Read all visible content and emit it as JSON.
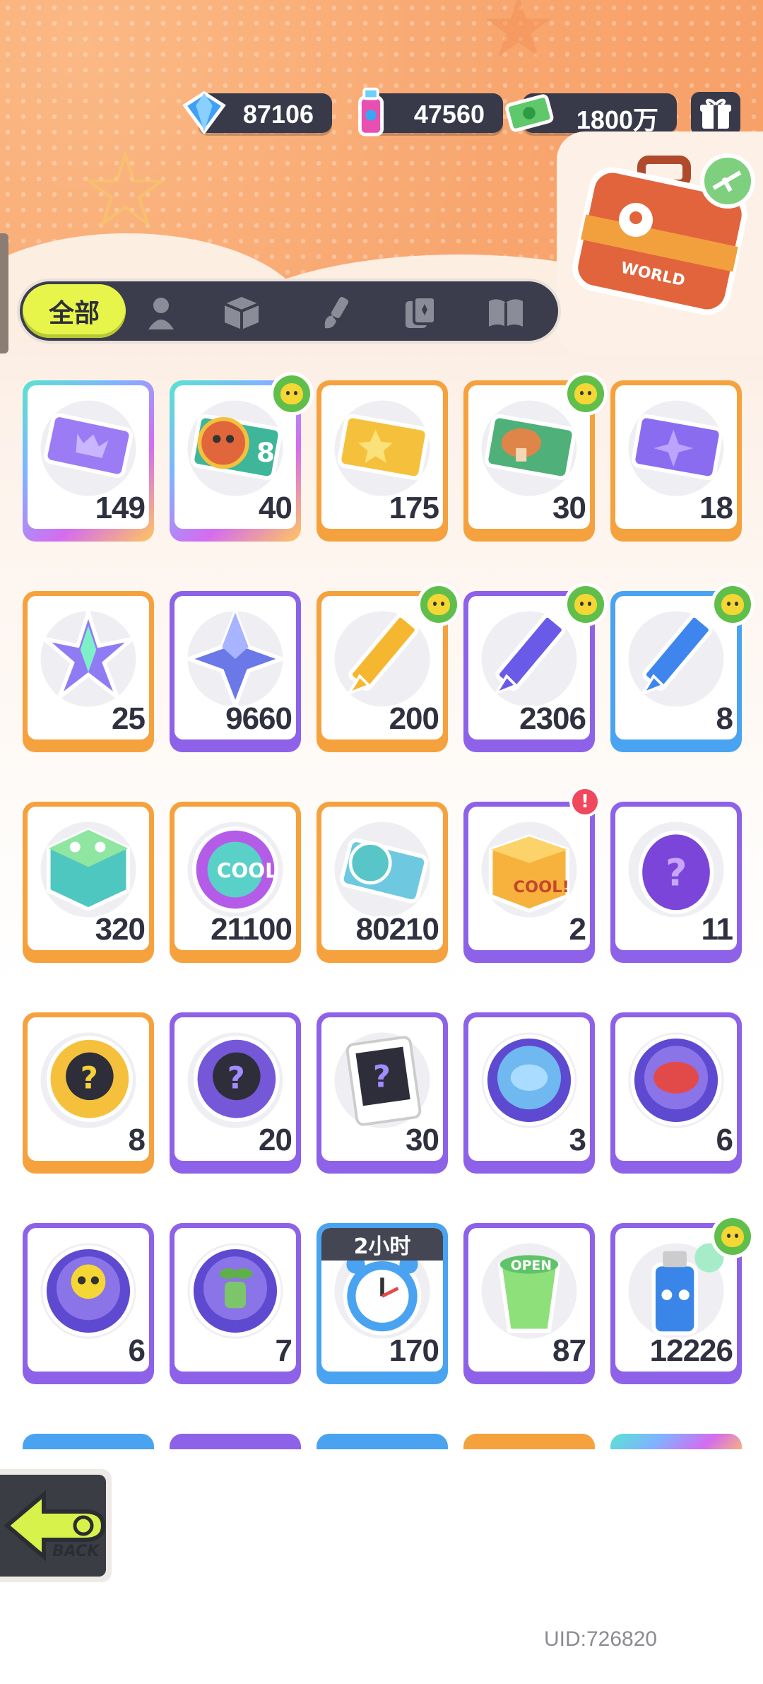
{
  "currencies": [
    {
      "name": "diamond",
      "value": "87106",
      "icon": "diamond-icon"
    },
    {
      "name": "spray-paint",
      "value": "47560",
      "icon": "spray-can-icon"
    },
    {
      "name": "cash",
      "value": "1800万",
      "icon": "money-icon"
    }
  ],
  "tabs": [
    {
      "label": "全部",
      "icon": "all",
      "selected": true
    },
    {
      "label": "",
      "icon": "person-icon"
    },
    {
      "label": "",
      "icon": "box-icon"
    },
    {
      "label": "",
      "icon": "brush-icon"
    },
    {
      "label": "",
      "icon": "cards-icon"
    },
    {
      "label": "",
      "icon": "book-icon"
    }
  ],
  "world_label": "WORLD",
  "items": [
    {
      "name": "crown-ticket",
      "count": "149",
      "frame": "rainbow",
      "art": "ticket-purple"
    },
    {
      "name": "lion-dance-ticket",
      "count": "40",
      "frame": "rainbow",
      "art": "ticket-lion",
      "badge": true
    },
    {
      "name": "gold-star-ticket",
      "count": "175",
      "frame": "orange",
      "art": "ticket-gold"
    },
    {
      "name": "mushroom-ticket",
      "count": "30",
      "frame": "orange",
      "art": "ticket-green",
      "badge": true
    },
    {
      "name": "purple-star-ticket",
      "count": "18",
      "frame": "orange",
      "art": "ticket-violet"
    },
    {
      "name": "rainbow-crystal",
      "count": "25",
      "frame": "orange",
      "art": "crystal-rainbow"
    },
    {
      "name": "blue-crystal",
      "count": "9660",
      "frame": "purple",
      "art": "crystal-blue"
    },
    {
      "name": "yellow-crayon",
      "count": "200",
      "frame": "orange",
      "art": "crayon-yellow",
      "badge": true
    },
    {
      "name": "purple-crayon",
      "count": "2306",
      "frame": "purple",
      "art": "crayon-purple",
      "badge": true
    },
    {
      "name": "blue-crayon",
      "count": "8",
      "frame": "blue",
      "art": "crayon-blue",
      "badge": true
    },
    {
      "name": "color-cube",
      "count": "320",
      "frame": "orange",
      "art": "cube"
    },
    {
      "name": "cool-badge",
      "count": "21100",
      "frame": "orange",
      "art": "cool"
    },
    {
      "name": "season-ticket",
      "count": "80210",
      "frame": "orange",
      "art": "season"
    },
    {
      "name": "cool-box",
      "count": "2",
      "frame": "purple",
      "art": "box",
      "alert": "!"
    },
    {
      "name": "mystery-egg",
      "count": "11",
      "frame": "purple",
      "art": "egg"
    },
    {
      "name": "deity-mystery-gold",
      "count": "8",
      "frame": "orange",
      "art": "deity-gold"
    },
    {
      "name": "deity-mystery-purple",
      "count": "20",
      "frame": "purple",
      "art": "deity-purple"
    },
    {
      "name": "travel-mystery-card",
      "count": "30",
      "frame": "purple",
      "art": "travel"
    },
    {
      "name": "pufferfish-orb",
      "count": "3",
      "frame": "purple",
      "art": "orb-fish"
    },
    {
      "name": "piranha-orb",
      "count": "6",
      "frame": "purple",
      "art": "orb-piranha"
    },
    {
      "name": "octopus-orb",
      "count": "6",
      "frame": "purple",
      "art": "orb-octo"
    },
    {
      "name": "sprout-orb",
      "count": "7",
      "frame": "purple",
      "art": "orb-sprout"
    },
    {
      "name": "alarm-clock",
      "count": "170",
      "frame": "blue",
      "art": "clock",
      "timer": "2小时"
    },
    {
      "name": "open-cup",
      "count": "87",
      "frame": "purple",
      "art": "cup"
    },
    {
      "name": "spray-can",
      "count": "12226",
      "frame": "purple",
      "art": "spray",
      "badge": true
    }
  ],
  "back_label": "BACK",
  "uid": "UID:726820"
}
